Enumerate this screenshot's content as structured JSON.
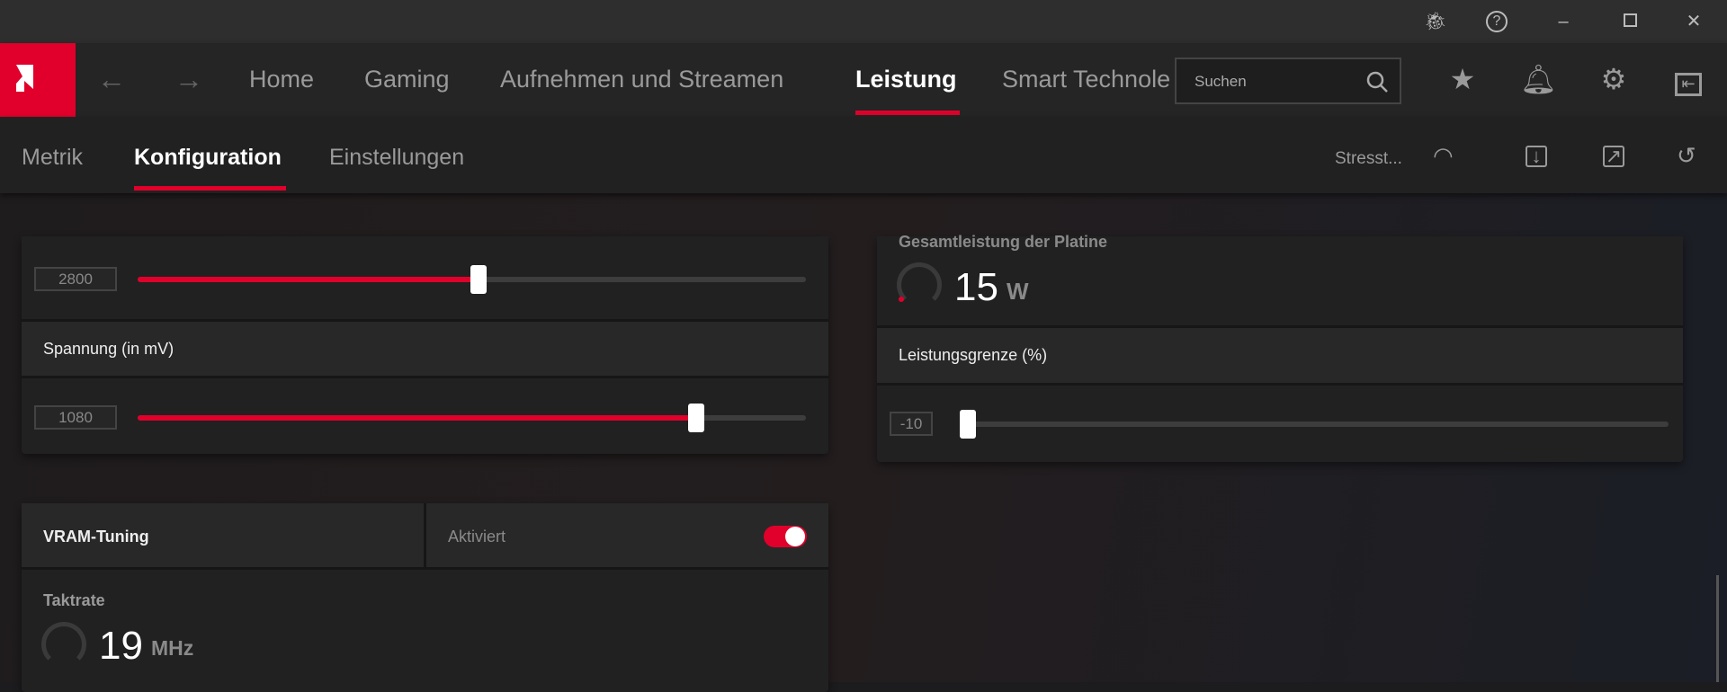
{
  "window": {
    "controls": [
      "debug-icon",
      "help-icon",
      "minimize-icon",
      "maximize-icon",
      "close-icon"
    ]
  },
  "nav": {
    "items": [
      {
        "label": "Home"
      },
      {
        "label": "Gaming"
      },
      {
        "label": "Aufnehmen und Streamen"
      },
      {
        "label": "Leistung"
      },
      {
        "label": "Smart Technole"
      }
    ],
    "active": "Leistung",
    "search_placeholder": "Suchen"
  },
  "subnav": {
    "items": [
      {
        "label": "Metrik"
      },
      {
        "label": "Konfiguration"
      },
      {
        "label": "Einstellungen"
      }
    ],
    "active": "Konfiguration",
    "stress_label": "Stresst..."
  },
  "left": {
    "clock_slider": {
      "value": "2800",
      "fraction": 0.51
    },
    "voltage": {
      "label": "Spannung (in mV)",
      "value": "1080",
      "fraction": 0.836
    },
    "vram": {
      "title": "VRAM-Tuning",
      "state": "Aktiviert",
      "enabled": true,
      "metric_label": "Taktrate",
      "metric_value": "19",
      "metric_unit": "MHz"
    }
  },
  "right": {
    "power": {
      "label": "Gesamtleistung der Platine",
      "value": "15",
      "unit": "W"
    },
    "limit": {
      "label": "Leistungsgrenze (%)",
      "value": "-10",
      "fraction": 0.0
    }
  },
  "colors": {
    "accent": "#e0002b"
  }
}
